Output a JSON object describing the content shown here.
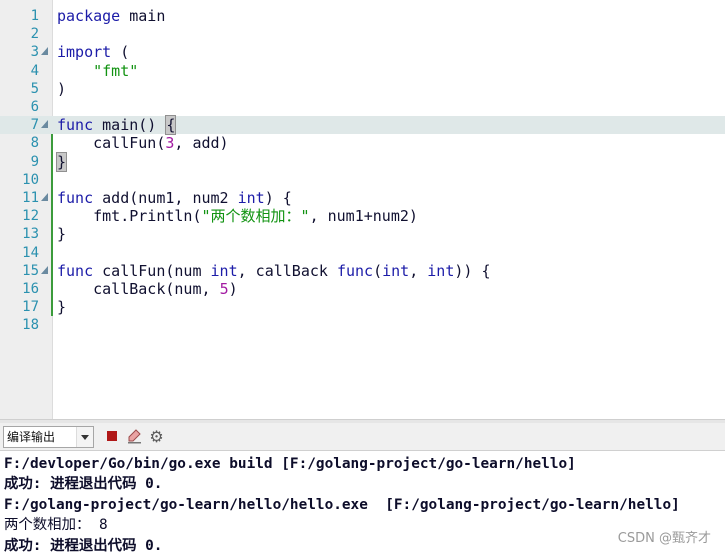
{
  "editor": {
    "lines": [
      {
        "n": "1"
      },
      {
        "n": "2"
      },
      {
        "n": "3"
      },
      {
        "n": "4"
      },
      {
        "n": "5"
      },
      {
        "n": "6"
      },
      {
        "n": "7"
      },
      {
        "n": "8"
      },
      {
        "n": "9"
      },
      {
        "n": "10"
      },
      {
        "n": "11"
      },
      {
        "n": "12"
      },
      {
        "n": "13"
      },
      {
        "n": "14"
      },
      {
        "n": "15"
      },
      {
        "n": "16"
      },
      {
        "n": "17"
      },
      {
        "n": "18"
      }
    ],
    "tokens": {
      "l1": {
        "kw": "package",
        "rest": " main"
      },
      "l3": {
        "kw": "import",
        "rest": " ("
      },
      "l4": {
        "str": "\"fmt\""
      },
      "l5": {
        "rest": ")"
      },
      "l7": {
        "kw": "func",
        "rest": " main() ",
        "brace": "{"
      },
      "l8": {
        "pre": "callFun(",
        "num": "3",
        "post": ", add)"
      },
      "l9": {
        "brace": "}"
      },
      "l11": {
        "kw": "func",
        "a": " add(num1, num2 ",
        "kw2": "int",
        "b": ") {"
      },
      "l12": {
        "pre": "fmt.Println(",
        "str": "\"两个数相加：\"",
        "post": ", num1+num2)"
      },
      "l13": {
        "rest": "}"
      },
      "l15": {
        "kw": "func",
        "a": " callFun(num ",
        "kw2": "int",
        "b": ", callBack ",
        "kw3": "func",
        "c": "(",
        "kw4": "int",
        "d": ", ",
        "kw5": "int",
        "e": ")) {"
      },
      "l16": {
        "pre": "callBack(num, ",
        "num": "5",
        "post": ")"
      },
      "l17": {
        "rest": "}"
      }
    }
  },
  "toolbar": {
    "output_select": "编译输出",
    "stop_icon": "stop-icon",
    "clear_icon": "clear-icon",
    "settings_icon": "gear-icon"
  },
  "output": {
    "lines": [
      "F:/devloper/Go/bin/go.exe build [F:/golang-project/go-learn/hello]",
      "成功: 进程退出代码 0.",
      "F:/golang-project/go-learn/hello/hello.exe  [F:/golang-project/go-learn/hello]",
      "两个数相加： 8",
      "成功: 进程退出代码 0."
    ]
  },
  "watermark": "CSDN @甄齐才",
  "colors": {
    "keyword": "#1c1ca8",
    "string": "#129312",
    "number": "#a21aa2",
    "line_number": "#2b91af",
    "current_line": "#dfe8e8"
  }
}
